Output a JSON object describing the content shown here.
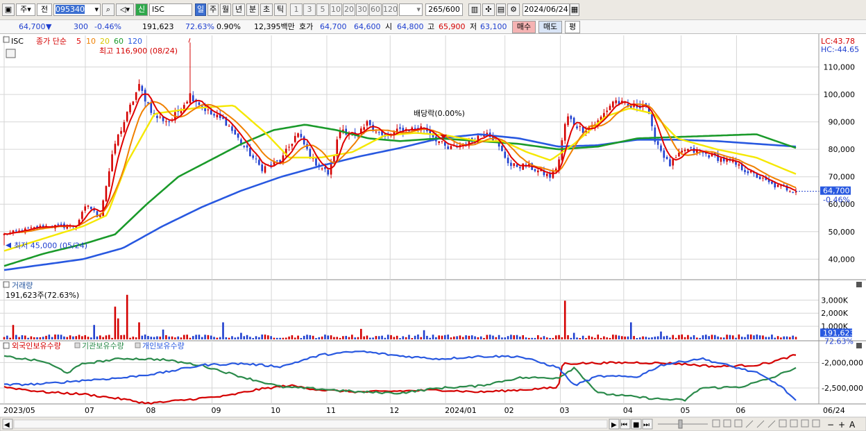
{
  "toolbar": {
    "market": "주",
    "prev": "전",
    "code": "095340",
    "new_label": "신",
    "name": "ISC",
    "periods": [
      "일",
      "주",
      "월",
      "년",
      "분",
      "초",
      "틱"
    ],
    "active_period": "일",
    "intervals": [
      "1",
      "3",
      "5",
      "10",
      "20",
      "30",
      "60",
      "120"
    ],
    "count": "265",
    "count_total": "/600",
    "date": "2024/06/24"
  },
  "quote": {
    "price": "64,700",
    "arrow": "▼",
    "change": "300",
    "change_pct": "-0.46%",
    "volume": "191,623",
    "volume_pct": "72.63%",
    "turnover_pct": "0.90%",
    "amount": "12,395백만",
    "ask_label": "호가",
    "ask": "64,700",
    "bid": "64,600",
    "open_label": "시",
    "open": "64,800",
    "high_label": "고",
    "high": "65,900",
    "low_label": "저",
    "low": "63,100",
    "buy_label": "매수",
    "sell_label": "매도",
    "eval_label": "평"
  },
  "colors": {
    "up": "#d40000",
    "down": "#1f3fcf",
    "ma5": "#e00000",
    "ma10": "#f08000",
    "ma20": "#f5e800",
    "ma60": "#1a9a2a",
    "ma120": "#2858e0",
    "foreign": "#d40000",
    "institution": "#2a8a4a",
    "individual": "#2858e0",
    "grid": "#d6d6d6"
  },
  "chart_data": [
    {
      "type": "line",
      "title": "ISC",
      "legend_prefix": "종가 단순",
      "ma_periods": [
        "5",
        "10",
        "20",
        "60",
        "120"
      ],
      "ylim": [
        33000,
        120000
      ],
      "y_ticks": [
        "40,000",
        "50,000",
        "60,000",
        "70,000",
        "80,000",
        "90,000",
        "100,000",
        "110,000"
      ],
      "y_tick_values": [
        40000,
        50000,
        60000,
        70000,
        80000,
        90000,
        100000,
        110000
      ],
      "x_labels": [
        "2023/05",
        "07",
        "08",
        "09",
        "10",
        "11",
        "12",
        "2024/01",
        "02",
        "03",
        "04",
        "05",
        "06"
      ],
      "x_label_frac": [
        0,
        0.1025,
        0.18,
        0.2625,
        0.3375,
        0.4075,
        0.4875,
        0.5575,
        0.6325,
        0.7025,
        0.7825,
        0.855,
        0.925
      ],
      "right_label": "06/24",
      "lc": "LC:43.78",
      "hc": "HC:-44.65",
      "current_price": "64,700",
      "current_price_value": 64700,
      "current_change": "-0.46%",
      "max_annotation": "최고 116,900 (08/24)",
      "max_value": 116900,
      "min_annotation": "최저 45,000 (05/24)",
      "min_value": 45000,
      "dividend_annotation": "배당락(0.00%)",
      "close_anchors": [
        [
          0,
          49000
        ],
        [
          0.05,
          52000
        ],
        [
          0.09,
          52000
        ],
        [
          0.105,
          60000
        ],
        [
          0.12,
          55000
        ],
        [
          0.14,
          82000
        ],
        [
          0.17,
          103000
        ],
        [
          0.19,
          92000
        ],
        [
          0.21,
          90000
        ],
        [
          0.235,
          100000
        ],
        [
          0.26,
          93000
        ],
        [
          0.28,
          90000
        ],
        [
          0.3,
          82000
        ],
        [
          0.325,
          73000
        ],
        [
          0.35,
          76000
        ],
        [
          0.37,
          86000
        ],
        [
          0.39,
          76000
        ],
        [
          0.41,
          71000
        ],
        [
          0.425,
          88000
        ],
        [
          0.445,
          84000
        ],
        [
          0.46,
          90000
        ],
        [
          0.48,
          84000
        ],
        [
          0.5,
          87000
        ],
        [
          0.53,
          88000
        ],
        [
          0.56,
          80000
        ],
        [
          0.59,
          83000
        ],
        [
          0.61,
          87000
        ],
        [
          0.64,
          74000
        ],
        [
          0.66,
          74000
        ],
        [
          0.69,
          70000
        ],
        [
          0.7,
          75000
        ],
        [
          0.71,
          92000
        ],
        [
          0.73,
          87000
        ],
        [
          0.75,
          90000
        ],
        [
          0.77,
          98000
        ],
        [
          0.79,
          95000
        ],
        [
          0.81,
          97000
        ],
        [
          0.82,
          85000
        ],
        [
          0.84,
          74000
        ],
        [
          0.86,
          80000
        ],
        [
          0.89,
          78000
        ],
        [
          0.92,
          75000
        ],
        [
          0.945,
          71000
        ],
        [
          0.97,
          67000
        ],
        [
          1,
          64700
        ]
      ],
      "ma20_anchors": [
        [
          0,
          43000
        ],
        [
          0.1,
          52000
        ],
        [
          0.13,
          56000
        ],
        [
          0.155,
          75000
        ],
        [
          0.19,
          93000
        ],
        [
          0.24,
          95000
        ],
        [
          0.29,
          96000
        ],
        [
          0.33,
          86000
        ],
        [
          0.36,
          77000
        ],
        [
          0.4,
          77000
        ],
        [
          0.44,
          79000
        ],
        [
          0.48,
          85000
        ],
        [
          0.52,
          86000
        ],
        [
          0.56,
          85000
        ],
        [
          0.6,
          83000
        ],
        [
          0.63,
          83000
        ],
        [
          0.66,
          79000
        ],
        [
          0.69,
          76000
        ],
        [
          0.72,
          82000
        ],
        [
          0.76,
          92000
        ],
        [
          0.79,
          95000
        ],
        [
          0.82,
          93000
        ],
        [
          0.85,
          84000
        ],
        [
          0.9,
          80000
        ],
        [
          0.95,
          77000
        ],
        [
          1,
          71000
        ]
      ],
      "ma60_anchors": [
        [
          0,
          37500
        ],
        [
          0.05,
          42000
        ],
        [
          0.1,
          45500
        ],
        [
          0.14,
          49000
        ],
        [
          0.18,
          60000
        ],
        [
          0.22,
          70000
        ],
        [
          0.26,
          76000
        ],
        [
          0.3,
          82000
        ],
        [
          0.34,
          87000
        ],
        [
          0.38,
          89000
        ],
        [
          0.42,
          87000
        ],
        [
          0.46,
          84000
        ],
        [
          0.5,
          83000
        ],
        [
          0.55,
          84000
        ],
        [
          0.6,
          83000
        ],
        [
          0.65,
          82000
        ],
        [
          0.7,
          80000
        ],
        [
          0.75,
          81000
        ],
        [
          0.8,
          84000
        ],
        [
          0.85,
          84500
        ],
        [
          0.9,
          85000
        ],
        [
          0.95,
          85500
        ],
        [
          1,
          80500
        ]
      ],
      "ma120_anchors": [
        [
          0,
          36000
        ],
        [
          0.1,
          40000
        ],
        [
          0.15,
          44000
        ],
        [
          0.2,
          52000
        ],
        [
          0.25,
          59000
        ],
        [
          0.3,
          65000
        ],
        [
          0.35,
          70000
        ],
        [
          0.4,
          74000
        ],
        [
          0.45,
          77500
        ],
        [
          0.5,
          80500
        ],
        [
          0.55,
          84000
        ],
        [
          0.6,
          85500
        ],
        [
          0.65,
          84000
        ],
        [
          0.7,
          81000
        ],
        [
          0.75,
          81500
        ],
        [
          0.8,
          83500
        ],
        [
          0.85,
          83500
        ],
        [
          0.9,
          83000
        ],
        [
          0.95,
          82000
        ],
        [
          1,
          81000
        ]
      ]
    },
    {
      "type": "bar",
      "title": "거래량",
      "value_label": "191,623주(72.63%)",
      "ylim": [
        0,
        3600000
      ],
      "y_ticks": [
        "1,000K",
        "2,000K",
        "3,000K"
      ],
      "y_tick_values": [
        1000000,
        2000000,
        3000000
      ],
      "current": "191,623",
      "current_value": 191623,
      "current_pct": "72.63%",
      "baseline": 200000,
      "spikes": [
        [
          0.01,
          1100000
        ],
        [
          0.115,
          1100000
        ],
        [
          0.14,
          2500000
        ],
        [
          0.145,
          1600000
        ],
        [
          0.155,
          3400000
        ],
        [
          0.17,
          1300000
        ],
        [
          0.2,
          750000
        ],
        [
          0.275,
          1300000
        ],
        [
          0.3,
          500000
        ],
        [
          0.45,
          800000
        ],
        [
          0.53,
          700000
        ],
        [
          0.71,
          2950000
        ],
        [
          0.72,
          500000
        ],
        [
          0.79,
          1300000
        ],
        [
          0.83,
          600000
        ],
        [
          1,
          191623
        ]
      ]
    },
    {
      "type": "line",
      "title": "보유수량",
      "series": [
        {
          "name": "외국인보유수량",
          "anchors": [
            [
              0,
              -2480000
            ],
            [
              0.05,
              -2580000
            ],
            [
              0.1,
              -2620000
            ],
            [
              0.15,
              -2720000
            ],
            [
              0.18,
              -2800000
            ],
            [
              0.2,
              -2780000
            ],
            [
              0.25,
              -2700000
            ],
            [
              0.28,
              -2660000
            ],
            [
              0.32,
              -2530000
            ],
            [
              0.36,
              -2450000
            ],
            [
              0.4,
              -2540000
            ],
            [
              0.45,
              -2580000
            ],
            [
              0.5,
              -2560000
            ],
            [
              0.55,
              -2540000
            ],
            [
              0.6,
              -2580000
            ],
            [
              0.65,
              -2540000
            ],
            [
              0.7,
              -2490000
            ],
            [
              0.705,
              -2020000
            ],
            [
              0.75,
              -2010000
            ],
            [
              0.8,
              -2000000
            ],
            [
              0.85,
              -2020000
            ],
            [
              0.9,
              -2080000
            ],
            [
              0.95,
              -2050000
            ],
            [
              0.97,
              -1990000
            ],
            [
              1,
              -1850000
            ]
          ]
        },
        {
          "name": "기관보유수량",
          "anchors": [
            [
              0,
              -1880000
            ],
            [
              0.05,
              -1980000
            ],
            [
              0.08,
              -2200000
            ],
            [
              0.1,
              -2020000
            ],
            [
              0.15,
              -1920000
            ],
            [
              0.2,
              -1940000
            ],
            [
              0.25,
              -2060000
            ],
            [
              0.3,
              -2280000
            ],
            [
              0.35,
              -2480000
            ],
            [
              0.4,
              -2520000
            ],
            [
              0.45,
              -2580000
            ],
            [
              0.5,
              -2600000
            ],
            [
              0.55,
              -2500000
            ],
            [
              0.6,
              -2460000
            ],
            [
              0.65,
              -2300000
            ],
            [
              0.7,
              -2300000
            ],
            [
              0.72,
              -2100000
            ],
            [
              0.75,
              -2600000
            ],
            [
              0.8,
              -2680000
            ],
            [
              0.83,
              -2720000
            ],
            [
              0.86,
              -2740000
            ],
            [
              0.88,
              -2500000
            ],
            [
              0.93,
              -2480000
            ],
            [
              0.97,
              -2300000
            ],
            [
              1,
              -2100000
            ]
          ]
        },
        {
          "name": "개인보유수량",
          "anchors": [
            [
              0,
              -2440000
            ],
            [
              0.05,
              -2420000
            ],
            [
              0.1,
              -2350000
            ],
            [
              0.15,
              -2300000
            ],
            [
              0.2,
              -2200000
            ],
            [
              0.25,
              -2050000
            ],
            [
              0.3,
              -2020000
            ],
            [
              0.35,
              -2080000
            ],
            [
              0.4,
              -1850000
            ],
            [
              0.45,
              -1780000
            ],
            [
              0.5,
              -1870000
            ],
            [
              0.55,
              -1930000
            ],
            [
              0.6,
              -1880000
            ],
            [
              0.65,
              -1880000
            ],
            [
              0.7,
              -2100000
            ],
            [
              0.72,
              -2450000
            ],
            [
              0.75,
              -2270000
            ],
            [
              0.8,
              -2280000
            ],
            [
              0.83,
              -2050000
            ],
            [
              0.88,
              -1920000
            ],
            [
              0.92,
              -2080000
            ],
            [
              0.95,
              -2200000
            ],
            [
              0.98,
              -2450000
            ],
            [
              1,
              -2750000
            ]
          ]
        }
      ],
      "ylim": [
        -2800000,
        -1750000
      ],
      "y_ticks": [
        "-2,000,000",
        "-2,500,000"
      ],
      "y_tick_values": [
        -2000000,
        -2500000
      ]
    }
  ],
  "bottom": {
    "scroll_left": "◀",
    "controls": [
      "▶",
      "⏮",
      "■",
      "⏭"
    ],
    "tools": [
      "−",
      "+",
      "A"
    ]
  }
}
